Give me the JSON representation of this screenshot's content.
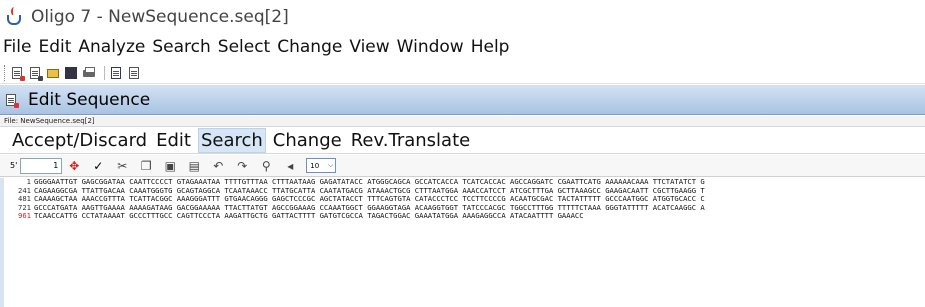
{
  "window": {
    "title": "Oligo 7 - NewSequence.seq[2]"
  },
  "menu": [
    "File",
    "Edit",
    "Analyze",
    "Search",
    "Select",
    "Change",
    "View",
    "Window",
    "Help"
  ],
  "edit_panel": {
    "title": "Edit Sequence",
    "file_label": "File: NewSequence.seq[2]"
  },
  "commands": [
    "Accept/Discard",
    "Edit",
    "Search",
    "Change",
    "Rev.Translate"
  ],
  "controls": {
    "strand_label": "5'",
    "position_value": "1",
    "zoom_value": "10"
  },
  "sequence_lines": [
    {
      "num": "1",
      "seq": "GGGGAATTGT GAGCGGATAA CAATTCCCCT GTAGAAATAA TTTTGTTTAA CTTTAATAAG GAGATATACC ATGGGCAGCA GCCATCACCA TCATCACCAC AGCCAGGATC CGAATTCATG AAAAAACAAA TTCTATATCT G"
    },
    {
      "num": "241",
      "seq": "CAGAAGGCGA TTATTGACAA CAAATGGGTG GCAGTAGGCA TCAATAAACC TTATGCATTA CAATATGACG ATAAACTGCG CTTTAATGGA AAACCATCCT ATCGCTTTGA GCTTAAAGCC GAAGACAATT CGCTTGAAGG T"
    },
    {
      "num": "481",
      "seq": "CAAAAGCTAA AAACCGTTTA TCATTACGGC AAAGGGATTT GTGAACAGGG GAGCTCCCGC AGCTATACCT TTTCAGTGTA CATACCCTCC TCCTTCCCCG ACAATGCGAC TACTATTTTT GCCCAATGGC ATGGTGCACC C"
    },
    {
      "num": "721",
      "seq": "GCCCATGATA AAGTTGAAAA AAAAGATAAG GACGGAAAAA TTACTTATGT AGCCGGAAAG CCAAATGGCT GGAAGGTAGA ACAAGGTGGT TATCCCACGC TGGCCTTTGG TTTTTCTAAA GGGTATTTTT ACATCAAGGC A"
    },
    {
      "num": "961",
      "seq": "TCAACCATTG CCTATAAAAT GCCCTTTGCC CAGTTCCCTA AAGATTGCTG GATTACTTTT GATGTCGCCA TAGACTGGAC GAAATATGGA AAAGAGGCCA ATACAATTTT GAAACC"
    }
  ],
  "colors": {
    "line_number_red": "#d61c1c",
    "panel_header": "#a9c3e2"
  }
}
